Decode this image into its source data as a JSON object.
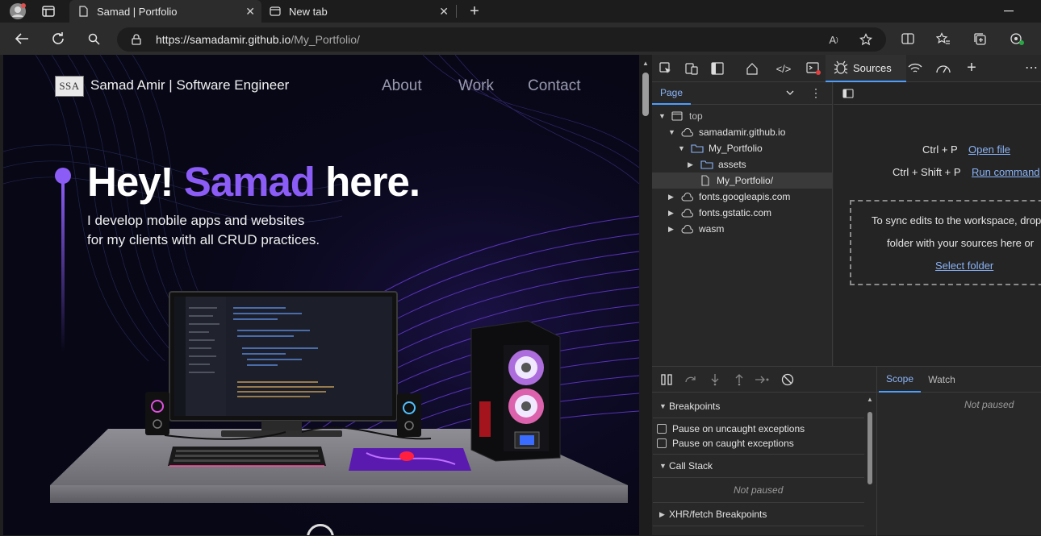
{
  "browser": {
    "tabs": [
      {
        "label": "Samad | Portfolio",
        "active": true
      },
      {
        "label": "New tab",
        "active": false
      }
    ],
    "url_host": "https://samadamir.github.io",
    "url_path": "/My_Portfolio/"
  },
  "site": {
    "logo_text": "SSA",
    "brand": "Samad Amir | Software Engineer",
    "nav": [
      "About",
      "Work",
      "Contact"
    ],
    "hero_hey": "Hey!",
    "hero_name": "Samad",
    "hero_here": "here.",
    "hero_line1": "I develop mobile apps and websites",
    "hero_line2": "for my clients with all CRUD practices.",
    "accent": "#7b4dff"
  },
  "devtools": {
    "active_tab": "Sources",
    "navigator_tab": "Page",
    "tree": {
      "top": "top",
      "host": "samadamir.github.io",
      "folder": "My_Portfolio",
      "assets": "assets",
      "file": "My_Portfolio/",
      "fonts_apis": "fonts.googleapis.com",
      "fonts_static": "fonts.gstatic.com",
      "wasm": "wasm"
    },
    "editor": {
      "shortcut1": "Ctrl + P",
      "action1": "Open file",
      "shortcut2": "Ctrl + Shift + P",
      "action2": "Run command",
      "sync_line1": "To sync edits to the workspace, drop",
      "sync_line2": "folder with your sources here or",
      "select_folder": "Select folder"
    },
    "debugger": {
      "breakpoints": "Breakpoints",
      "pause_uncaught": "Pause on uncaught exceptions",
      "pause_caught": "Pause on caught exceptions",
      "call_stack": "Call Stack",
      "not_paused": "Not paused",
      "xhr": "XHR/fetch Breakpoints",
      "scope_tab": "Scope",
      "watch_tab": "Watch",
      "scope_not_paused": "Not paused"
    }
  }
}
